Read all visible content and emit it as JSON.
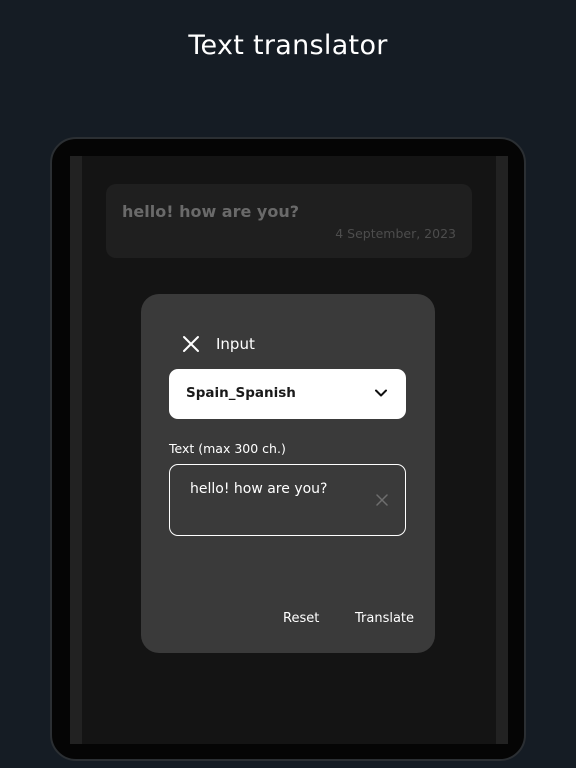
{
  "headline": "Text translator",
  "history": {
    "text": "hello! how are you?",
    "date": "4 September, 2023"
  },
  "dialog": {
    "title": "Input",
    "language": {
      "selected": "Spain_Spanish"
    },
    "text_field": {
      "label": "Text (max 300 ch.)",
      "value": "hello! how are you?"
    },
    "actions": {
      "reset": "Reset",
      "translate": "Translate"
    }
  },
  "colors": {
    "background": "#151c24",
    "dialog": "#3a3a3a",
    "screen": "#141414"
  },
  "icons": {
    "close": "close-icon",
    "chevron": "chevron-down-icon",
    "clear": "clear-icon"
  }
}
